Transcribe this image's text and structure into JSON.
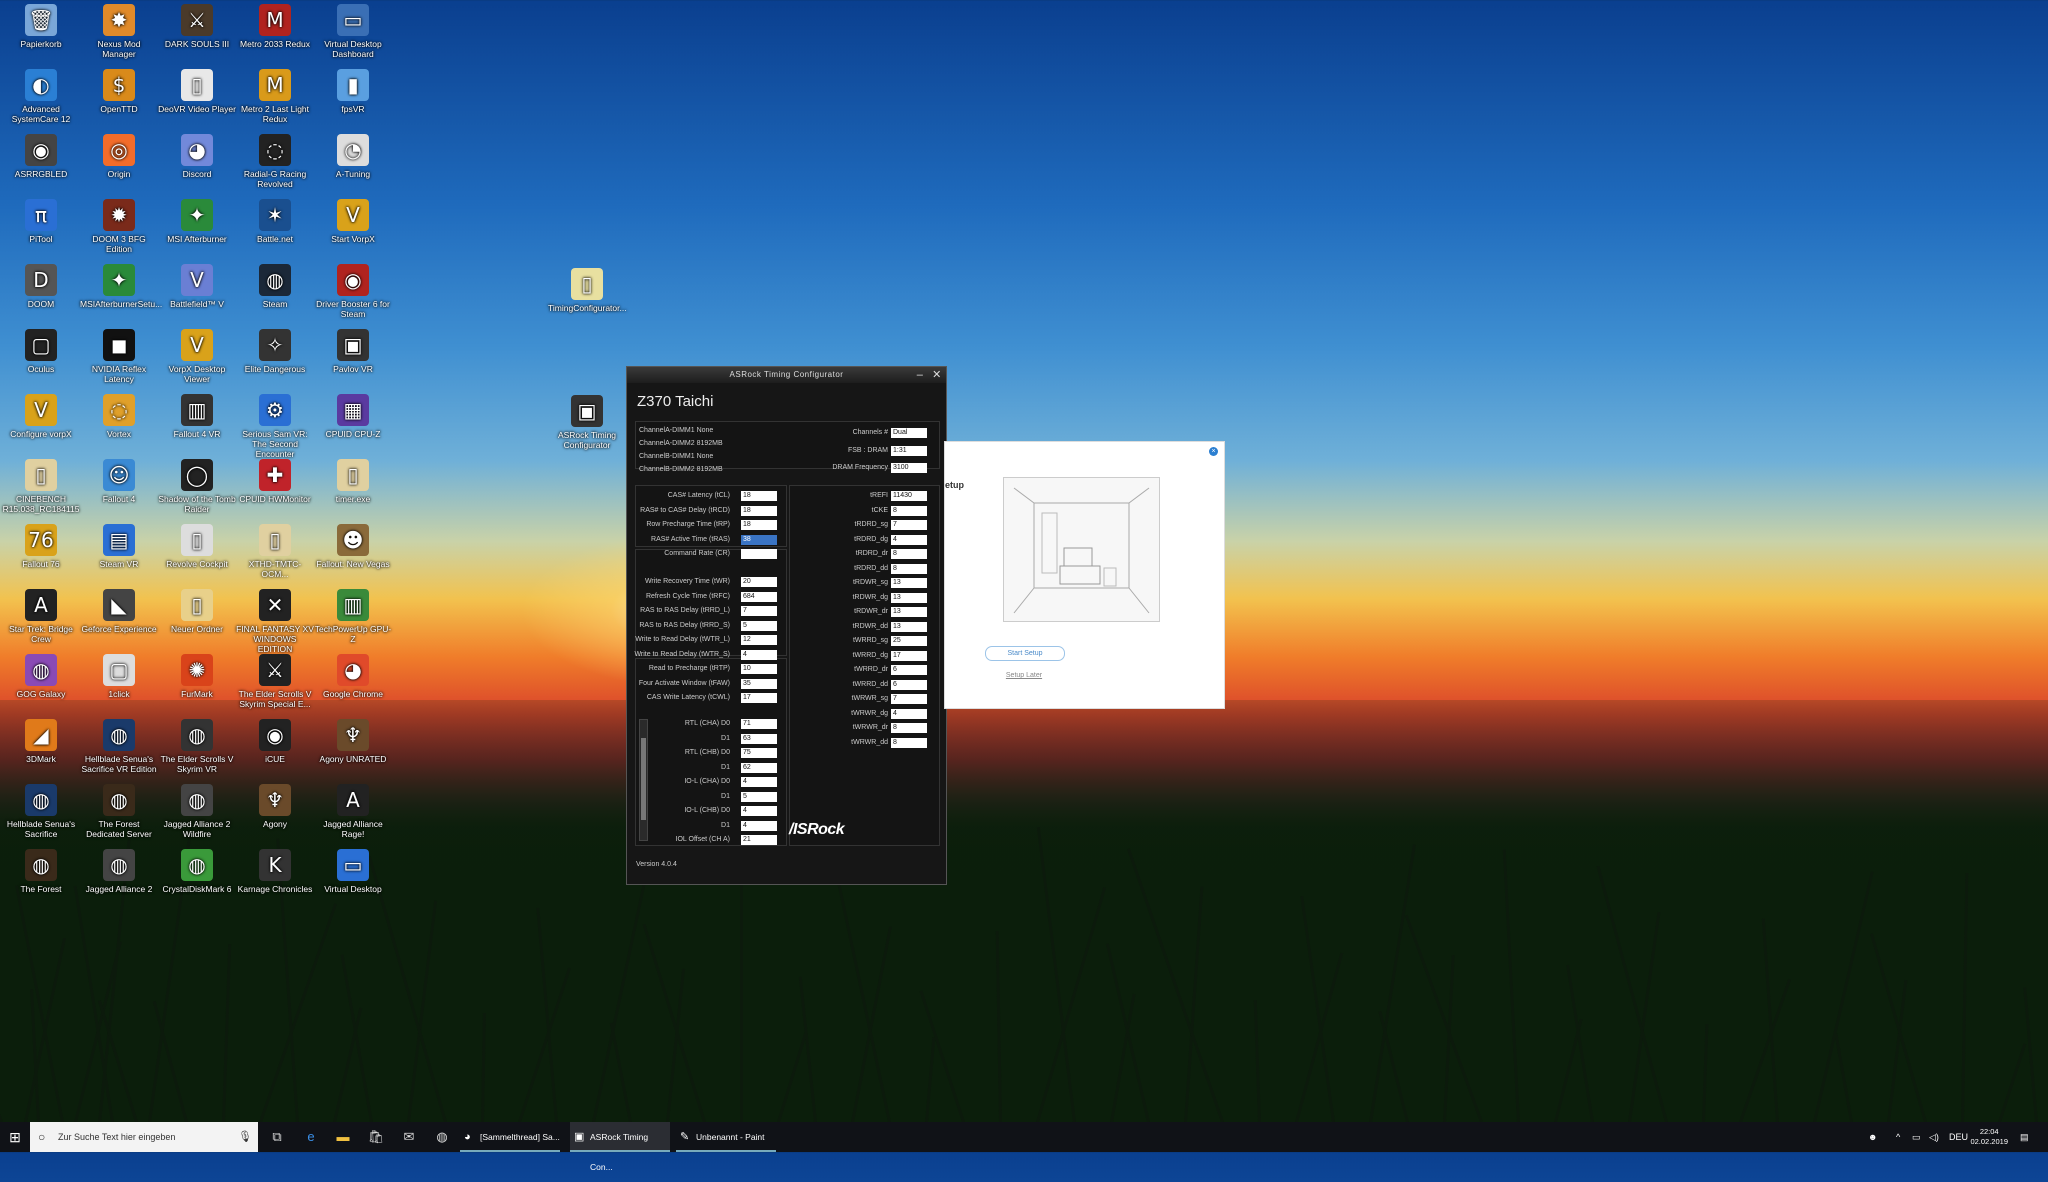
{
  "desktop": {
    "icons": [
      {
        "label": "Papierkorb",
        "glyph": "🗑",
        "color": "#7aa7d8"
      },
      {
        "label": "Nexus Mod Manager",
        "glyph": "✸",
        "color": "#e08a2a"
      },
      {
        "label": "DARK SOULS III",
        "glyph": "⚔",
        "color": "#4a3a2a"
      },
      {
        "label": "Metro 2033 Redux",
        "glyph": "M",
        "color": "#b0231f"
      },
      {
        "label": "Virtual Desktop Dashboard",
        "glyph": "▭",
        "color": "#3a6fb5"
      },
      {
        "label": "Advanced SystemCare 12",
        "glyph": "◐",
        "color": "#2a7fd4"
      },
      {
        "label": "OpenTTD",
        "glyph": "$",
        "color": "#d98a1a"
      },
      {
        "label": "DeoVR Video Player",
        "glyph": "▯",
        "color": "#e8e8e8"
      },
      {
        "label": "Metro 2 Last Light Redux",
        "glyph": "M",
        "color": "#d99a1a"
      },
      {
        "label": "fpsVR",
        "glyph": "▮",
        "color": "#5a9fe0"
      },
      {
        "label": "ASRRGBLED",
        "glyph": "◉",
        "color": "#444"
      },
      {
        "label": "Origin",
        "glyph": "◎",
        "color": "#f26c2a"
      },
      {
        "label": "Discord",
        "glyph": "◕",
        "color": "#7289da"
      },
      {
        "label": "Radial-G Racing Revolved",
        "glyph": "◌",
        "color": "#222"
      },
      {
        "label": "A-Tuning",
        "glyph": "◔",
        "color": "#ddd"
      },
      {
        "label": "PiTool",
        "glyph": "π",
        "color": "#2a6fd4"
      },
      {
        "label": "DOOM 3 BFG Edition",
        "glyph": "✹",
        "color": "#7a2a1a"
      },
      {
        "label": "MSI Afterburner",
        "glyph": "✦",
        "color": "#2a8a3a"
      },
      {
        "label": "Battle.net",
        "glyph": "✶",
        "color": "#1a4f8f"
      },
      {
        "label": "Start VorpX",
        "glyph": "V",
        "color": "#d9a21a"
      },
      {
        "label": "DOOM",
        "glyph": "D",
        "color": "#555"
      },
      {
        "label": "MSIAfterburnerSetu...",
        "glyph": "✦",
        "color": "#2a8a3a"
      },
      {
        "label": "Battlefield™ V",
        "glyph": "V",
        "color": "#6a7fd4"
      },
      {
        "label": "Steam",
        "glyph": "◍",
        "color": "#1b2838"
      },
      {
        "label": "Driver Booster 6 for Steam",
        "glyph": "◉",
        "color": "#b0231f"
      },
      {
        "label": "Oculus",
        "glyph": "▢",
        "color": "#222"
      },
      {
        "label": "NVIDIA Reflex Latency",
        "glyph": "◼",
        "color": "#111"
      },
      {
        "label": "VorpX Desktop Viewer",
        "glyph": "V",
        "color": "#d9a21a"
      },
      {
        "label": "Elite Dangerous",
        "glyph": "✧",
        "color": "#333"
      },
      {
        "label": "Pavlov VR",
        "glyph": "▣",
        "color": "#333"
      },
      {
        "label": "Configure vorpX",
        "glyph": "V",
        "color": "#d9a21a"
      },
      {
        "label": "Vortex",
        "glyph": "◌",
        "color": "#e0a02a"
      },
      {
        "label": "Fallout 4 VR",
        "glyph": "▥",
        "color": "#333"
      },
      {
        "label": "Serious Sam VR: The Second Encounter",
        "glyph": "⚙",
        "color": "#2a6fd4"
      },
      {
        "label": "CPUID CPU-Z",
        "glyph": "▦",
        "color": "#5a3aa0"
      },
      {
        "label": "CINEBENCH R15.038_RC184115",
        "glyph": "▯",
        "color": "#e0d0a0"
      },
      {
        "label": "Fallout 4",
        "glyph": "☺",
        "color": "#3a8ad4"
      },
      {
        "label": "Shadow of the Tomb Raider",
        "glyph": "◯",
        "color": "#222"
      },
      {
        "label": "CPUID HWMonitor",
        "glyph": "✚",
        "color": "#c0232a"
      },
      {
        "label": "timer.exe",
        "glyph": "▯",
        "color": "#e0d0a0"
      },
      {
        "label": "Fallout 76",
        "glyph": "76",
        "color": "#d9a21a"
      },
      {
        "label": "Steam VR",
        "glyph": "▤",
        "color": "#2a6fd4"
      },
      {
        "label": "Revolve Cockpit",
        "glyph": "▯",
        "color": "#ddd"
      },
      {
        "label": "XTHD-TMTC-OCM...",
        "glyph": "▯",
        "color": "#e0d0a0"
      },
      {
        "label": "Fallout: New Vegas",
        "glyph": "☻",
        "color": "#8a6a3a"
      },
      {
        "label": "Star Trek: Bridge Crew",
        "glyph": "A",
        "color": "#222"
      },
      {
        "label": "Geforce Experience",
        "glyph": "◣",
        "color": "#444"
      },
      {
        "label": "Neuer Ordner",
        "glyph": "▯",
        "color": "#e8d08a"
      },
      {
        "label": "FINAL FANTASY XV WINDOWS EDITION",
        "glyph": "✕",
        "color": "#222"
      },
      {
        "label": "TechPowerUp GPU-Z",
        "glyph": "▥",
        "color": "#3a8a3a"
      },
      {
        "label": "GOG Galaxy",
        "glyph": "◍",
        "color": "#8a4ab5"
      },
      {
        "label": "1click",
        "glyph": "▢",
        "color": "#ddd"
      },
      {
        "label": "FurMark",
        "glyph": "✺",
        "color": "#d9431a"
      },
      {
        "label": "The Elder Scrolls V Skyrim Special E...",
        "glyph": "⚔",
        "color": "#222"
      },
      {
        "label": "Google Chrome",
        "glyph": "◕",
        "color": "#e04a2a"
      },
      {
        "label": "3DMark",
        "glyph": "◢",
        "color": "#e07a1a"
      },
      {
        "label": "Hellblade Senua's Sacrifice VR Edition",
        "glyph": "◍",
        "color": "#1a3a6a"
      },
      {
        "label": "The Elder Scrolls V Skyrim VR",
        "glyph": "◍",
        "color": "#333"
      },
      {
        "label": "iCUE",
        "glyph": "◉",
        "color": "#222"
      },
      {
        "label": "Agony UNRATED",
        "glyph": "♆",
        "color": "#6a4a2a"
      },
      {
        "label": "Hellblade Senua's Sacrifice",
        "glyph": "◍",
        "color": "#1a3a6a"
      },
      {
        "label": "The Forest Dedicated Server",
        "glyph": "◍",
        "color": "#3a2a1a"
      },
      {
        "label": "Jagged Alliance 2 Wildfire",
        "glyph": "◍",
        "color": "#444"
      },
      {
        "label": "Agony",
        "glyph": "♆",
        "color": "#6a4a2a"
      },
      {
        "label": "Jagged Alliance Rage!",
        "glyph": "A",
        "color": "#222"
      },
      {
        "label": "The Forest",
        "glyph": "◍",
        "color": "#3a2a1a"
      },
      {
        "label": "Jagged Alliance 2",
        "glyph": "◍",
        "color": "#444"
      },
      {
        "label": "CrystalDiskMark 6",
        "glyph": "◍",
        "color": "#3a9a3a"
      },
      {
        "label": "Karnage Chronicles",
        "glyph": "K",
        "color": "#333"
      },
      {
        "label": "Virtual Desktop",
        "glyph": "▭",
        "color": "#2a6fd4"
      },
      {
        "label": "TimingConfigurator...",
        "glyph": "▯",
        "color": "#e8e0a0"
      },
      {
        "label": "ASRock Timing Configurator",
        "glyph": "▣",
        "color": "#333"
      }
    ]
  },
  "asrock": {
    "title": "ASRock Timing Configurator",
    "board": "Z370 Taichi",
    "dimms": [
      "ChannelA-DIMM1  None",
      "ChannelA-DIMM2  8192MB",
      "ChannelB-DIMM1  None",
      "ChannelB-DIMM2  8192MB"
    ],
    "channels": {
      "label": "Channels #",
      "value": "Dual"
    },
    "fsb": {
      "label": "FSB : DRAM",
      "value": "1:31"
    },
    "freq": {
      "label": "DRAM Frequency",
      "value": "3100"
    },
    "primary": [
      {
        "label": "CAS# Latency (tCL)",
        "value": "18"
      },
      {
        "label": "RAS# to CAS# Delay (tRCD)",
        "value": "18"
      },
      {
        "label": "Row Precharge Time (tRP)",
        "value": "18"
      },
      {
        "label": "RAS# Active Time (tRAS)",
        "value": "38"
      },
      {
        "label": "Command Rate (CR)",
        "value": ""
      }
    ],
    "secondary": [
      {
        "label": "Write Recovery Time (tWR)",
        "value": "20"
      },
      {
        "label": "Refresh Cycle Time (tRFC)",
        "value": "684"
      },
      {
        "label": "RAS to RAS Delay (tRRD_L)",
        "value": "7"
      },
      {
        "label": "RAS to RAS Delay (tRRD_S)",
        "value": "5"
      },
      {
        "label": "Write to Read Delay (tWTR_L)",
        "value": "12"
      },
      {
        "label": "Write to Read Delay (tWTR_S)",
        "value": "4"
      },
      {
        "label": "Read to Precharge (tRTP)",
        "value": "10"
      },
      {
        "label": "Four Activate Window (tFAW)",
        "value": "35"
      },
      {
        "label": "CAS Write Latency (tCWL)",
        "value": "17"
      }
    ],
    "rtl": [
      {
        "label": "RTL (CHA) D0",
        "value": "71"
      },
      {
        "label": "D1",
        "value": "63"
      },
      {
        "label": "RTL (CHB) D0",
        "value": "75"
      },
      {
        "label": "D1",
        "value": "62"
      },
      {
        "label": "IO-L (CHA) D0",
        "value": "4"
      },
      {
        "label": "D1",
        "value": "5"
      },
      {
        "label": "IO-L (CHB) D0",
        "value": "4"
      },
      {
        "label": "D1",
        "value": "4"
      },
      {
        "label": "IOL Offset (CH A)",
        "value": "21"
      }
    ],
    "tertiary": [
      {
        "label": "tREFI",
        "value": "11430"
      },
      {
        "label": "tCKE",
        "value": "8"
      },
      {
        "label": "tRDRD_sg",
        "value": "7"
      },
      {
        "label": "tRDRD_dg",
        "value": "4"
      },
      {
        "label": "tRDRD_dr",
        "value": "8"
      },
      {
        "label": "tRDRD_dd",
        "value": "8"
      },
      {
        "label": "tRDWR_sg",
        "value": "13"
      },
      {
        "label": "tRDWR_dg",
        "value": "13"
      },
      {
        "label": "tRDWR_dr",
        "value": "13"
      },
      {
        "label": "tRDWR_dd",
        "value": "13"
      },
      {
        "label": "tWRRD_sg",
        "value": "25"
      },
      {
        "label": "tWRRD_dg",
        "value": "17"
      },
      {
        "label": "tWRRD_dr",
        "value": "6"
      },
      {
        "label": "tWRRD_dd",
        "value": "6"
      },
      {
        "label": "tWRWR_sg",
        "value": "7"
      },
      {
        "label": "tWRWR_dg",
        "value": "4"
      },
      {
        "label": "tWRWR_dr",
        "value": "8"
      },
      {
        "label": "tWRWR_dd",
        "value": "8"
      }
    ],
    "logo": "/ISRock",
    "version": "Version 4.0.4"
  },
  "setup": {
    "heading": "etup",
    "start": "Start Setup",
    "later": "Setup Later"
  },
  "taskbar": {
    "search_placeholder": "Zur Suche Text hier eingeben",
    "apps": [
      {
        "label": "[Sammelthread] Sa...",
        "icon": "◕"
      },
      {
        "label": "ASRock Timing Con...",
        "icon": "▣"
      },
      {
        "label": "Unbenannt - Paint",
        "icon": "✎"
      }
    ],
    "lang": "DEU",
    "time": "22:04",
    "date": "02.02.2019"
  }
}
